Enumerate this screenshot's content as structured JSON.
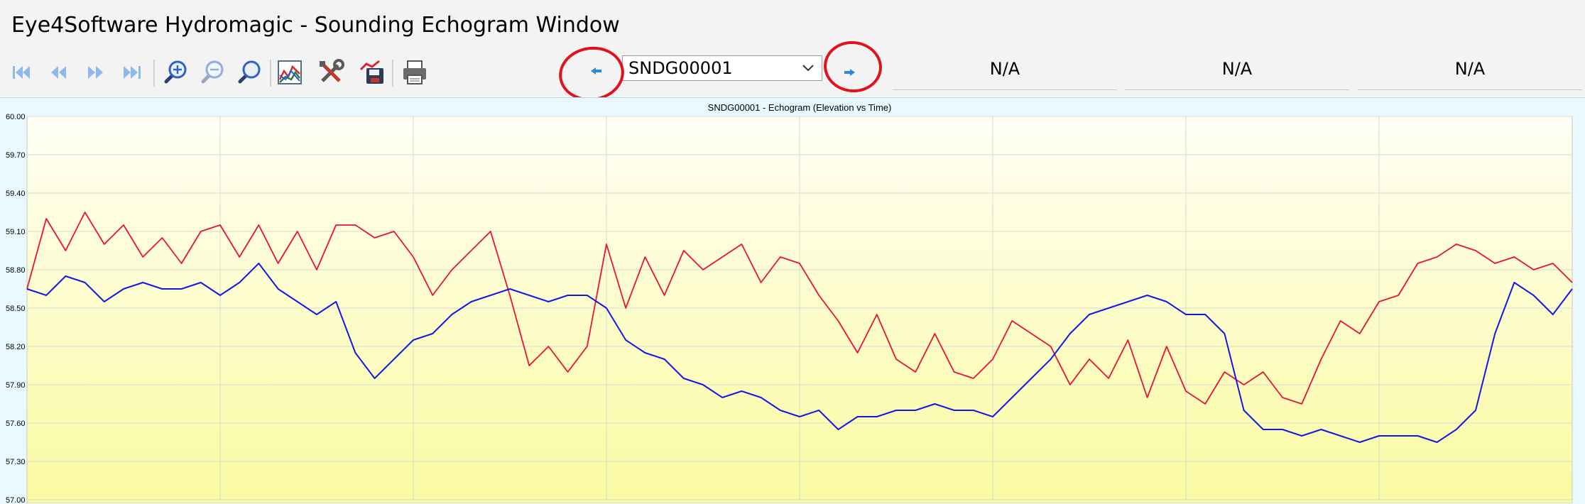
{
  "window": {
    "title": "Eye4Software Hydromagic - Sounding Echogram Window"
  },
  "toolbar": {
    "buttons": [
      {
        "name": "first-record-button",
        "icon": "skip-first-icon"
      },
      {
        "name": "previous-record-button",
        "icon": "rewind-icon"
      },
      {
        "name": "next-record-button",
        "icon": "forward-icon"
      },
      {
        "name": "last-record-button",
        "icon": "skip-last-icon"
      },
      {
        "name": "zoom-in-button",
        "icon": "zoom-in-icon"
      },
      {
        "name": "zoom-out-button",
        "icon": "zoom-out-icon"
      },
      {
        "name": "zoom-extents-button",
        "icon": "zoom-fit-icon"
      },
      {
        "name": "chart-settings-button",
        "icon": "chart-icon"
      },
      {
        "name": "tools-button",
        "icon": "tools-icon"
      },
      {
        "name": "export-button",
        "icon": "save-export-icon"
      },
      {
        "name": "print-button",
        "icon": "printer-icon"
      }
    ],
    "sounding_select": {
      "value": "SNDG00001"
    },
    "status_fields": [
      "N/A",
      "N/A",
      "N/A"
    ]
  },
  "colors": {
    "series_red": "#e8123c",
    "series_blue": "#1418e6",
    "annotation_red": "#e1121e",
    "plot_top": "#fffff6",
    "plot_bottom": "#fafaa0"
  },
  "chart_data": {
    "type": "line",
    "title": "SNDG00001 - Echogram (Elevation vs Time)",
    "ylim": [
      57.0,
      60.0
    ],
    "yticks": [
      "60.00",
      "59.70",
      "59.40",
      "59.10",
      "58.80",
      "58.50",
      "58.20",
      "57.90",
      "57.60",
      "57.30",
      "57.00"
    ],
    "grid": true,
    "x": [
      0,
      10,
      20,
      30,
      40,
      50,
      60,
      70,
      80,
      90,
      100,
      110,
      120,
      130,
      140,
      150,
      160,
      170,
      180,
      190,
      200,
      210,
      220,
      230,
      240,
      250,
      260,
      270,
      280,
      290,
      300,
      310,
      320,
      330,
      340,
      350,
      360,
      370,
      380,
      390,
      400,
      410,
      420,
      430,
      440,
      450,
      460,
      470,
      480,
      490,
      500,
      510,
      520,
      530,
      540,
      550,
      560,
      570,
      580,
      590,
      600,
      610,
      620,
      630,
      640,
      650,
      660,
      670,
      680,
      690,
      700,
      710,
      720,
      730,
      740,
      750,
      760,
      770,
      780,
      790,
      800
    ],
    "series": [
      {
        "values": [
          58.65,
          59.2,
          58.95,
          59.25,
          59.0,
          59.15,
          58.9,
          59.05,
          58.85,
          59.1,
          59.15,
          58.9,
          59.15,
          58.85,
          59.1,
          58.8,
          59.15,
          59.15,
          59.05,
          59.1,
          58.9,
          58.6,
          58.8,
          58.95,
          59.1,
          58.6,
          58.05,
          58.2,
          58.0,
          58.2,
          59.0,
          58.5,
          58.9,
          58.6,
          58.95,
          58.8,
          58.9,
          59.0,
          58.7,
          58.9,
          58.85,
          58.6,
          58.4,
          58.15,
          58.45,
          58.1,
          58.0,
          58.3,
          58.0,
          57.95,
          58.1,
          58.4,
          58.3,
          58.2,
          57.9,
          58.1,
          57.95,
          58.25,
          57.8,
          58.2,
          57.85,
          57.75,
          58.0,
          57.9,
          58.0,
          57.8,
          57.75,
          58.1,
          58.4,
          58.3,
          58.55,
          58.6,
          58.85,
          58.9,
          59.0,
          58.95,
          58.85,
          58.9,
          58.8,
          58.85,
          58.7
        ]
      },
      {
        "values": [
          58.65,
          58.6,
          58.75,
          58.7,
          58.55,
          58.65,
          58.7,
          58.65,
          58.65,
          58.7,
          58.6,
          58.7,
          58.85,
          58.65,
          58.55,
          58.45,
          58.55,
          58.15,
          57.95,
          58.1,
          58.25,
          58.3,
          58.45,
          58.55,
          58.6,
          58.65,
          58.6,
          58.55,
          58.6,
          58.6,
          58.5,
          58.25,
          58.15,
          58.1,
          57.95,
          57.9,
          57.8,
          57.85,
          57.8,
          57.7,
          57.65,
          57.7,
          57.55,
          57.65,
          57.65,
          57.7,
          57.7,
          57.75,
          57.7,
          57.7,
          57.65,
          57.8,
          57.95,
          58.1,
          58.3,
          58.45,
          58.5,
          58.55,
          58.6,
          58.55,
          58.45,
          58.45,
          58.3,
          57.7,
          57.55,
          57.55,
          57.5,
          57.55,
          57.5,
          57.45,
          57.5,
          57.5,
          57.5,
          57.45,
          57.55,
          57.7,
          58.3,
          58.7,
          58.6,
          58.45,
          58.65
        ]
      }
    ]
  }
}
